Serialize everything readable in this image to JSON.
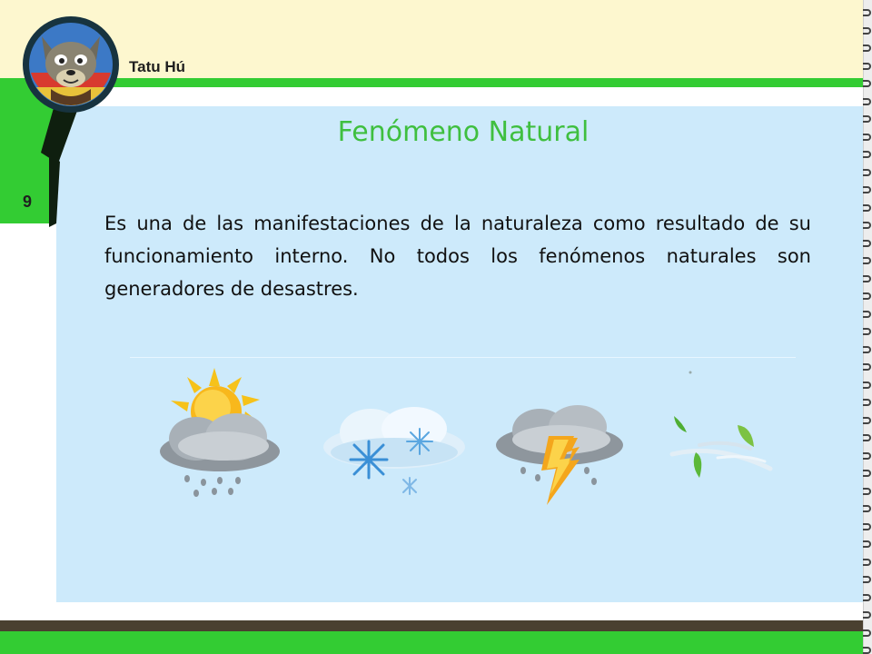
{
  "header": {
    "brand_label": "Tatu Hú"
  },
  "page": {
    "number": "9"
  },
  "main": {
    "title": "Fenómeno Natural",
    "paragraph": "Es una de las manifestaciones de la naturaleza como resultado de su funcionamiento interno. No todos los fenómenos naturales son generadores de desastres."
  },
  "weather_icons": [
    {
      "icon": "sun-cloud-rain-icon"
    },
    {
      "icon": "snow-cloud-icon"
    },
    {
      "icon": "thunderstorm-icon"
    },
    {
      "icon": "wind-leaves-icon"
    }
  ],
  "colors": {
    "accent_green": "#33cc33",
    "title_green": "#3fbf3f",
    "panel_blue": "#cdeafb",
    "header_cream": "#fdf7cf",
    "footer_brown": "#4a4030"
  }
}
